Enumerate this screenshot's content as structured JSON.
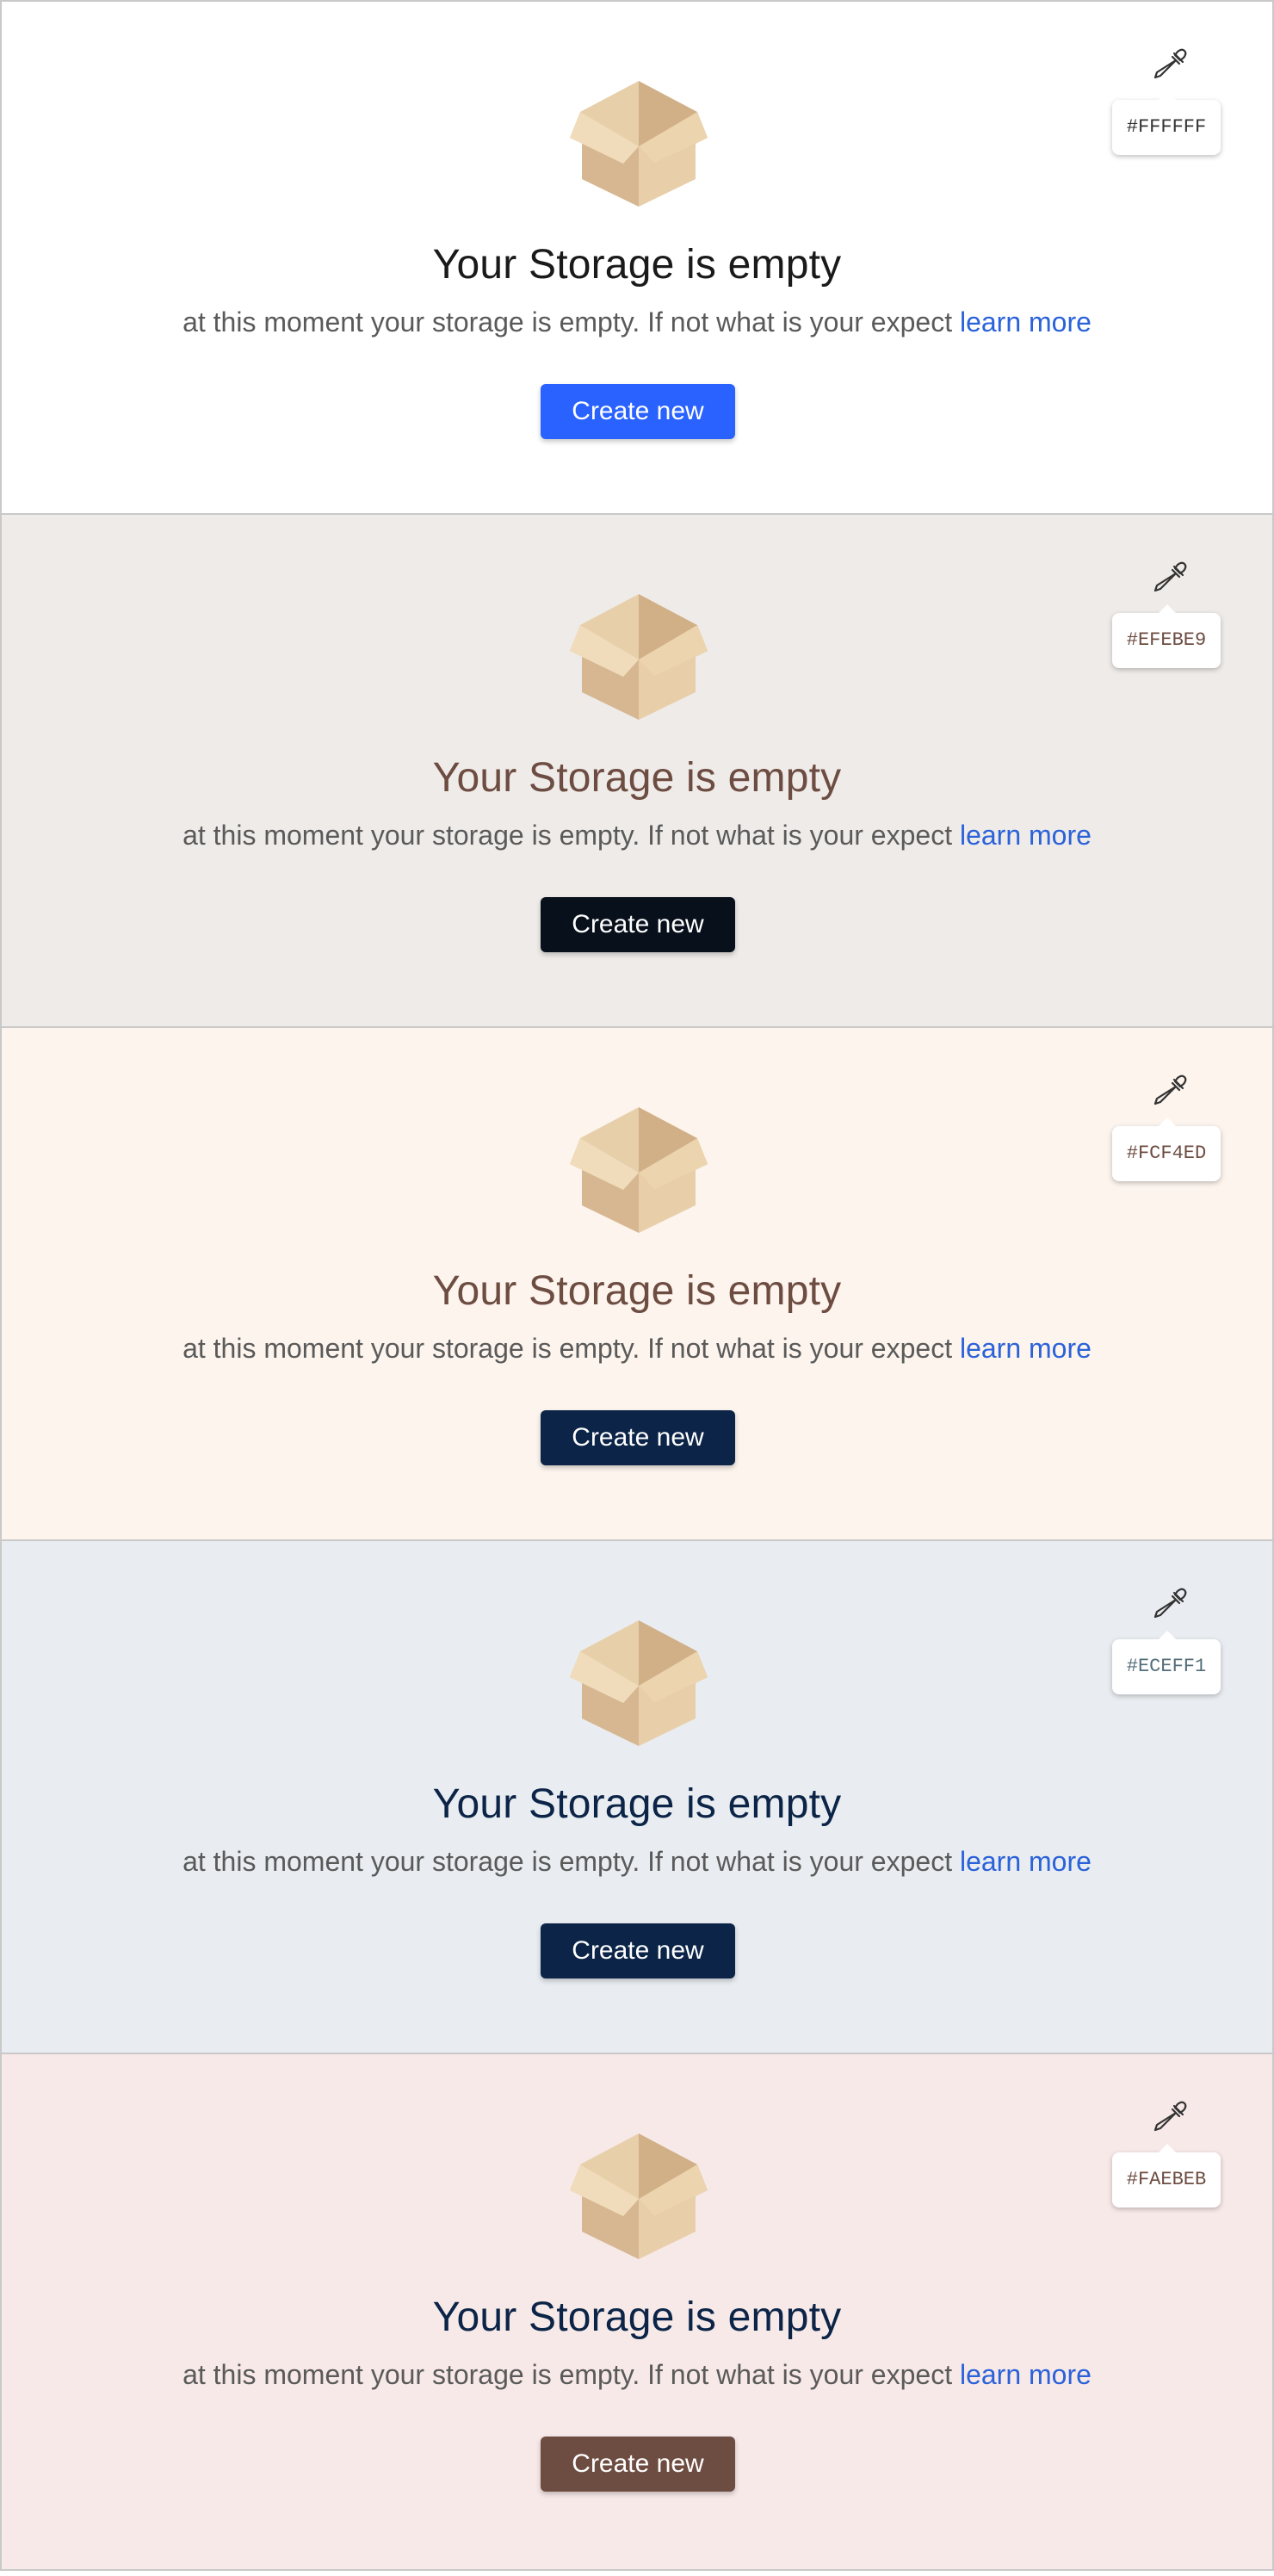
{
  "panels": [
    {
      "hex": "#FFFFFF",
      "title": "Your Storage is empty",
      "description": "at this moment your storage is empty. If not what is your expect",
      "link": "learn more",
      "button": "Create new",
      "colors": {
        "background": "#FFFFFF",
        "title": "#1a1a1a",
        "button": "#2962ff",
        "hex_text": "#333333"
      }
    },
    {
      "hex": "#EFEBE9",
      "title": "Your Storage is empty",
      "description": "at this moment your storage is empty. If not what is your expect",
      "link": "learn more",
      "button": "Create new",
      "colors": {
        "background": "#EFEBE9",
        "title": "#6d4c41",
        "button": "#08101c",
        "hex_text": "#6d4c41"
      }
    },
    {
      "hex": "#FCF4ED",
      "title": "Your Storage is empty",
      "description": "at this moment your storage is empty. If not what is your expect",
      "link": "learn more",
      "button": "Create new",
      "colors": {
        "background": "#FCF4ED",
        "title": "#6d4c41",
        "button": "#0b2447",
        "hex_text": "#6d4c41"
      }
    },
    {
      "hex": "#ECEFF1",
      "title": "Your Storage is empty",
      "description": "at this moment your storage is empty. If not what is your expect",
      "link": "learn more",
      "button": "Create new",
      "colors": {
        "background": "#E9EDF1",
        "title": "#0b2447",
        "button": "#0b2447",
        "hex_text": "#546e7a"
      }
    },
    {
      "hex": "#FAEBEB",
      "title": "Your Storage is empty",
      "description": "at this moment your storage is empty. If not what is your expect",
      "link": "learn more",
      "button": "Create new",
      "colors": {
        "background": "#F7E9E8",
        "title": "#0b2447",
        "button": "#6d4c41",
        "hex_text": "#6d4c41"
      }
    }
  ],
  "icons": {
    "empty_state": "open-box-icon",
    "color_picker": "eyedropper-icon"
  },
  "accent": {
    "link": "#2b62d9"
  }
}
